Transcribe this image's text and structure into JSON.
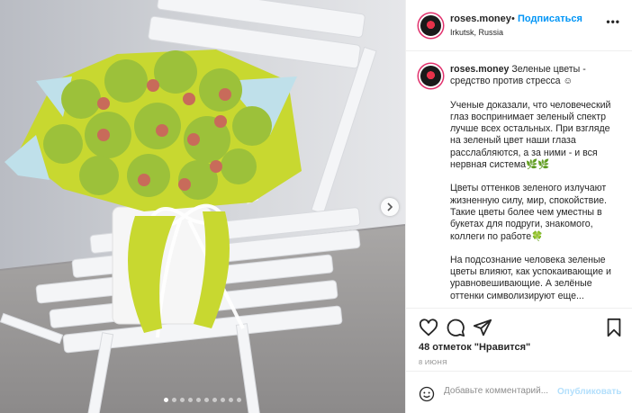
{
  "post": {
    "username": "roses.money",
    "follow_separator": "•",
    "follow_label": "Подписаться",
    "location": "Irkutsk, Russia",
    "more_icon": "more-dots-icon",
    "caption": {
      "lead": "Зеленые цветы - средство против стресса ☺",
      "p1": "Ученые доказали, что человеческий глаз воспринимает зеленый спектр лучше всех остальных. При взгляде на зеленый цвет наши глаза расслабляются, а за ними - и вся нервная система🌿🌿",
      "p2": "Цветы оттенков зеленого излучают жизненную силу, мир, спокойствие. Такие цветы более чем уместны в букетах для подруги, знакомого, коллеги по работе🍀",
      "p3": "На подсознание человека зеленые цветы влияют, как успокаивающие и уравновешивающие. А зелёные оттенки символизируют еще..."
    },
    "likes": "48 отметок \"Нравится\"",
    "date": "8 ИЮНЯ",
    "comment_placeholder": "Добавьте комментарий...",
    "publish_label": "Опубликовать",
    "carousel": {
      "total": 10,
      "active": 0
    },
    "icons": {
      "like": "heart-icon",
      "comment": "comment-icon",
      "share": "share-icon",
      "save": "bookmark-icon",
      "emoji": "smile-icon",
      "next": "chevron-right-icon"
    },
    "colors": {
      "accent": "#0095f6",
      "publish_disabled": "#b2dffc",
      "muted": "#8e8e8e"
    }
  }
}
